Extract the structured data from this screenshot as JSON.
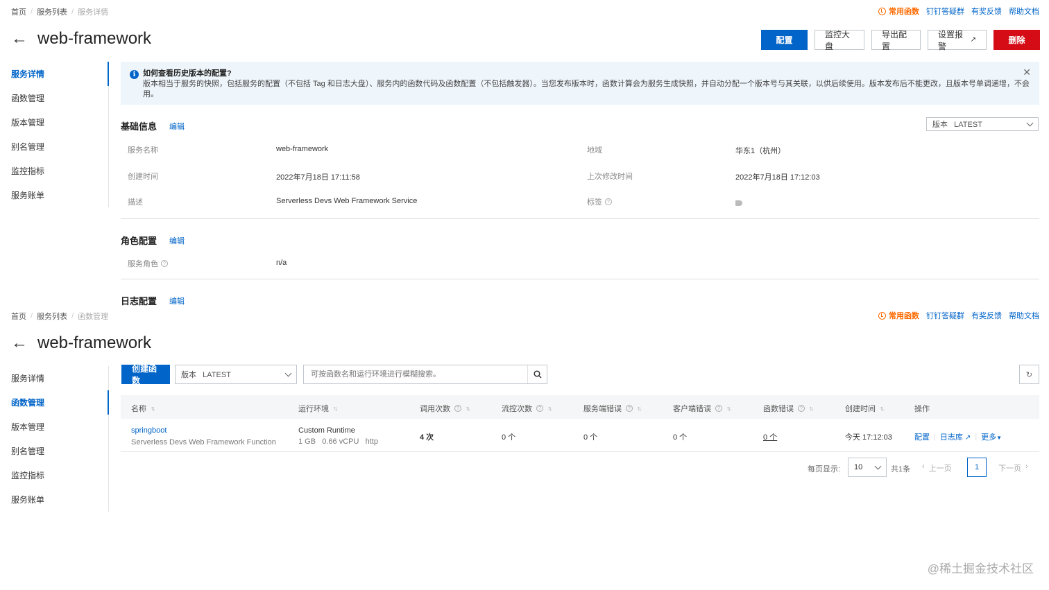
{
  "top": {
    "breadcrumb": [
      "首页",
      "服务列表",
      "服务详情"
    ],
    "links": {
      "hot": "常用函数",
      "dingtalk": "钉钉答疑群",
      "feedback": "有奖反馈",
      "help": "帮助文档"
    },
    "title": "web-framework",
    "buttons": {
      "config": "配置",
      "monitor": "监控大盘",
      "export": "导出配置",
      "alarm": "设置报警",
      "delete": "删除"
    },
    "sidebar": [
      "服务详情",
      "函数管理",
      "版本管理",
      "别名管理",
      "监控指标",
      "服务账单"
    ],
    "notice": {
      "title": "如何查看历史版本的配置?",
      "body": "版本相当于服务的快照，包括服务的配置（不包括 Tag 和日志大盘）、服务内的函数代码及函数配置（不包括触发器）。当您发布版本时，函数计算会为服务生成快照，并自动分配一个版本号与其关联，以供后续使用。版本发布后不能更改，且版本号单调递增，不会被重复使",
      "body2": "用。"
    },
    "basic": {
      "title": "基础信息",
      "edit": "编辑",
      "version_label": "版本",
      "version_value": "LATEST",
      "service_name_label": "服务名称",
      "service_name": "web-framework",
      "region_label": "地域",
      "region": "华东1（杭州）",
      "created_label": "创建时间",
      "created": "2022年7月18日 17:11:58",
      "modified_label": "上次修改时间",
      "modified": "2022年7月18日 17:12:03",
      "desc_label": "描述",
      "desc": "Serverless Devs Web Framework Service",
      "tags_label": "标签"
    },
    "role": {
      "title": "角色配置",
      "edit": "编辑",
      "label": "服务角色",
      "value": "n/a"
    },
    "log": {
      "title": "日志配置",
      "edit": "编辑"
    }
  },
  "bottom": {
    "breadcrumb": [
      "首页",
      "服务列表",
      "函数管理"
    ],
    "links": {
      "hot": "常用函数",
      "dingtalk": "钉钉答疑群",
      "feedback": "有奖反馈",
      "help": "帮助文档"
    },
    "title": "web-framework",
    "sidebar": [
      "服务详情",
      "函数管理",
      "版本管理",
      "别名管理",
      "监控指标",
      "服务账单"
    ],
    "create_button": "创建函数",
    "version_label": "版本",
    "version_value": "LATEST",
    "search_placeholder": "可按函数名和运行环境进行模糊搜索。",
    "columns": [
      "名称",
      "运行环境",
      "调用次数",
      "流控次数",
      "服务端错误",
      "客户端错误",
      "函数错误",
      "创建时间",
      "操作"
    ],
    "row": {
      "name": "springboot",
      "desc": "Serverless Devs Web Framework Function",
      "runtime": "Custom Runtime",
      "spec": "1 GB   0.66 vCPU   http",
      "invocations": "4 次",
      "throttles": "0 个",
      "server_errors": "0 个",
      "client_errors": "0 个",
      "function_errors": "0 个",
      "created": "今天 17:12:03",
      "op_config": "配置",
      "op_logs": "日志库",
      "op_more": "更多"
    },
    "pager": {
      "per_page_label": "每页显示:",
      "per_page": "10",
      "total": "共1条",
      "prev": "上一页",
      "page": "1",
      "next": "下一页"
    }
  },
  "watermark": "@稀土掘金技术社区"
}
